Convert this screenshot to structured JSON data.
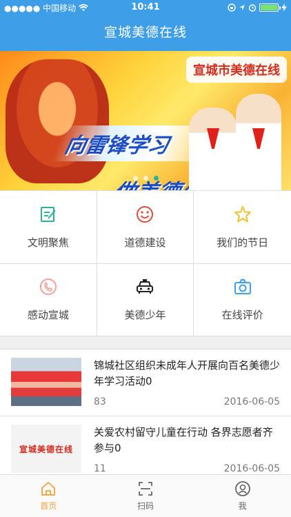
{
  "status_bar": {
    "carrier": "●●●●● 中国移动",
    "time": "10:41",
    "icons": [
      "wifi-icon",
      "orientation-lock-icon",
      "location-icon",
      "alarm-icon",
      "battery-icon",
      "charging-icon"
    ]
  },
  "nav": {
    "title": "宣城美德在线"
  },
  "banner": {
    "slogan_line1": "向雷锋学习",
    "slogan_line2": "做美德少年",
    "logo_text": "宣城市美德在线",
    "slide_count": 3,
    "active_slide": 3
  },
  "menu": [
    {
      "label": "文明聚焦",
      "icon": "edit-note-icon",
      "color": "#27b39b"
    },
    {
      "label": "道德建设",
      "icon": "smile-icon",
      "color": "#e0473a"
    },
    {
      "label": "我们的节日",
      "icon": "star-icon",
      "color": "#f2c12e"
    },
    {
      "label": "感动宣城",
      "icon": "phone-heart-icon",
      "color": "#f2a29a"
    },
    {
      "label": "美德少年",
      "icon": "car-icon",
      "color": "#222222"
    },
    {
      "label": "在线评价",
      "icon": "camera-icon",
      "color": "#3e9ee8"
    }
  ],
  "news": [
    {
      "title": "锦城社区组织未成年人开展向百名美德少年学习活动0",
      "views": "83",
      "date": "2016-06-05"
    },
    {
      "title": "关爱农村留守儿童在行动 各界志愿者齐参与0",
      "views": "11",
      "date": "2016-06-05",
      "thumb_text": "宣城美德在线"
    }
  ],
  "tabbar": [
    {
      "label": "首页",
      "icon": "home-icon",
      "active": true
    },
    {
      "label": "扫码",
      "icon": "scan-icon",
      "active": false
    },
    {
      "label": "我",
      "icon": "profile-icon",
      "active": false
    }
  ],
  "colors": {
    "primary": "#3e9ee8",
    "tab_active": "#f0a23b"
  }
}
